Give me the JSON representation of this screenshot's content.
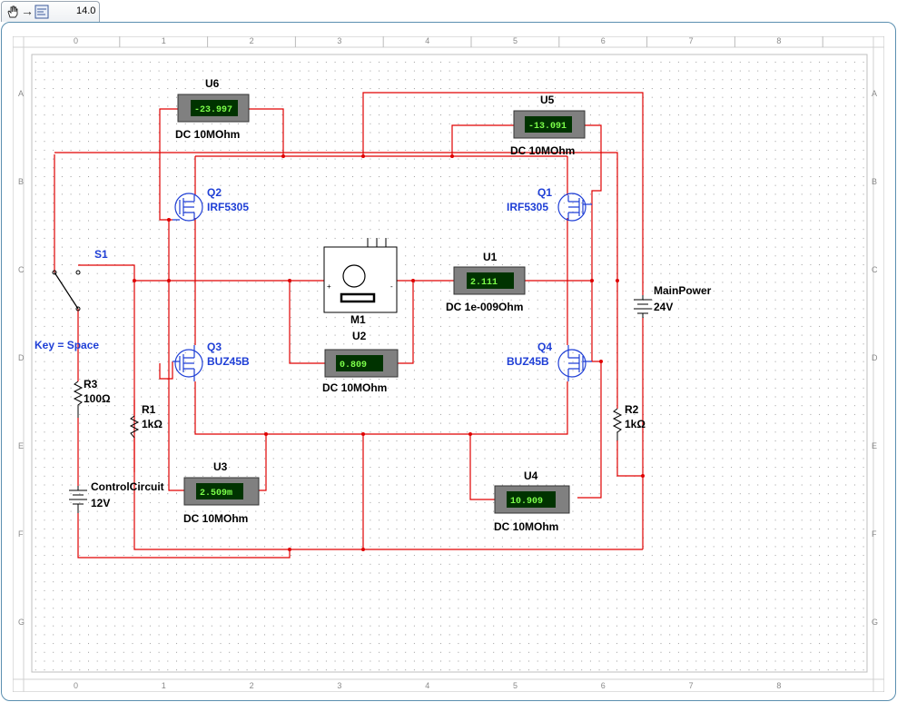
{
  "toolbar": {
    "hand_icon": "hand-pan-icon",
    "arrow_icon": "arrow-right-icon",
    "schematic_icon": "schematic-icon",
    "zoom_value": "14.0"
  },
  "ruler": {
    "columns": [
      "0",
      "1",
      "2",
      "3",
      "4",
      "5",
      "6",
      "7",
      "8"
    ],
    "rows": [
      "A",
      "B",
      "C",
      "D",
      "E",
      "F",
      "G"
    ]
  },
  "components": {
    "U6": {
      "ref": "U6",
      "reading": "-23.997",
      "mode": "DC  10MOhm"
    },
    "U5": {
      "ref": "U5",
      "reading": "-13.091",
      "mode": "DC  10MOhm"
    },
    "U1": {
      "ref": "U1",
      "reading": "2.111",
      "mode": "DC  1e-009Ohm"
    },
    "U2": {
      "ref": "U2",
      "reading": "0.809",
      "mode": "DC  10MOhm"
    },
    "U3": {
      "ref": "U3",
      "reading": "2.509m",
      "mode": "DC  10MOhm"
    },
    "U4": {
      "ref": "U4",
      "reading": "10.909",
      "mode": "DC  10MOhm"
    },
    "Q1": {
      "ref": "Q1",
      "part": "IRF5305"
    },
    "Q2": {
      "ref": "Q2",
      "part": "IRF5305"
    },
    "Q3": {
      "ref": "Q3",
      "part": "BUZ45B"
    },
    "Q4": {
      "ref": "Q4",
      "part": "BUZ45B"
    },
    "S1": {
      "ref": "S1",
      "key": "Key = Space"
    },
    "R1": {
      "ref": "R1",
      "value": "1kΩ"
    },
    "R2": {
      "ref": "R2",
      "value": "1kΩ"
    },
    "R3": {
      "ref": "R3",
      "value": "100Ω"
    },
    "M1": {
      "ref": "M1"
    },
    "MainPower": {
      "ref": "MainPower",
      "value": "24V"
    },
    "ControlCircuit": {
      "ref": "ControlCircuit",
      "value": "12V"
    }
  },
  "colors": {
    "wire": "#e00000",
    "component_blue": "#1f3fd6",
    "meter_display": "#003300",
    "meter_text": "#7cff4a"
  }
}
